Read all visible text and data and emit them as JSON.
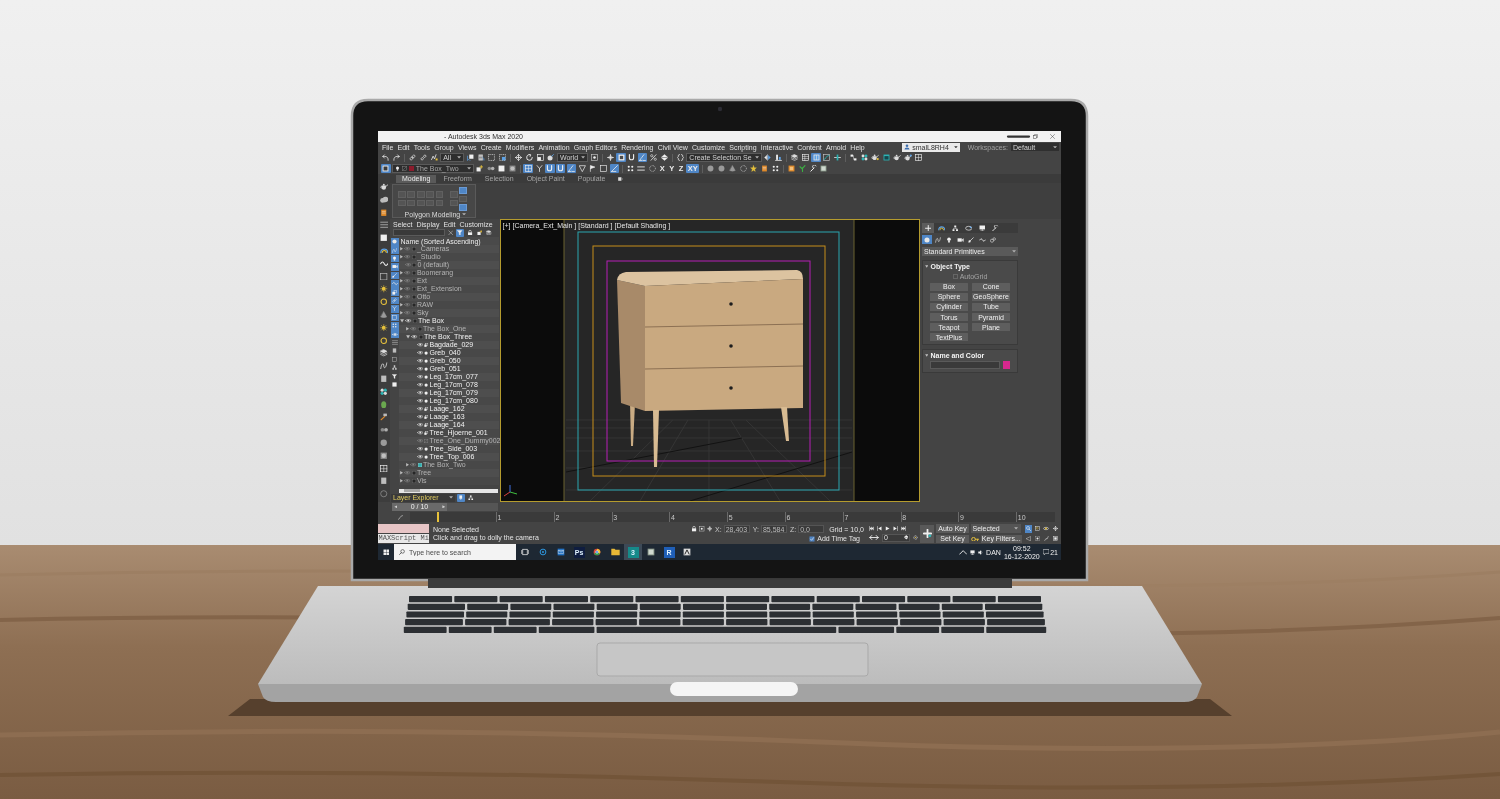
{
  "window": {
    "title": "- Autodesk 3ds Max 2020"
  },
  "menu_bar": {
    "items": [
      "File",
      "Edit",
      "Tools",
      "Group",
      "Views",
      "Create",
      "Modifiers",
      "Animation",
      "Graph Editors",
      "Rendering",
      "Civil View",
      "Customize",
      "Scripting",
      "Interactive",
      "Content",
      "Arnold",
      "Help"
    ],
    "user": "smalL8RH4",
    "workspaces_label": "Workspaces:",
    "workspace": "Default"
  },
  "main_toolbar": [
    {
      "kind": "undo",
      "on": false
    },
    {
      "kind": "redo",
      "on": false
    },
    {
      "kind": "separator"
    },
    {
      "kind": "link",
      "on": false
    },
    {
      "kind": "unlink",
      "on": false
    },
    {
      "kind": "bind",
      "on": false
    },
    {
      "kind": "dropdown",
      "value": "All"
    },
    {
      "kind": "select",
      "on": false
    },
    {
      "kind": "select_list",
      "on": false
    },
    {
      "kind": "region",
      "on": false
    },
    {
      "kind": "crossing",
      "on": false
    },
    {
      "kind": "separator"
    },
    {
      "kind": "move",
      "on": false
    },
    {
      "kind": "rotate",
      "on": false
    },
    {
      "kind": "scale",
      "on": false
    },
    {
      "kind": "placement",
      "on": false
    },
    {
      "kind": "dropdown",
      "value": "World"
    },
    {
      "kind": "pivot",
      "on": false
    },
    {
      "kind": "separator"
    },
    {
      "kind": "manipulate",
      "on": false
    },
    {
      "kind": "shortcut",
      "on": true
    },
    {
      "kind": "snap",
      "on": false
    },
    {
      "kind": "angle_snap",
      "on": true
    },
    {
      "kind": "percent_snap",
      "on": false
    },
    {
      "kind": "spinner_snap",
      "on": false
    },
    {
      "kind": "separator"
    },
    {
      "kind": "named_sets",
      "on": false
    },
    {
      "kind": "dropdown",
      "value": "Create Selection Se"
    },
    {
      "kind": "mirror",
      "on": false
    },
    {
      "kind": "align",
      "on": false
    },
    {
      "kind": "separator"
    },
    {
      "kind": "layers",
      "on": false
    },
    {
      "kind": "explorer",
      "on": false
    },
    {
      "kind": "ribbon",
      "on": true
    },
    {
      "kind": "curve_editor",
      "on": false
    },
    {
      "kind": "dope",
      "on": false
    },
    {
      "kind": "separator"
    },
    {
      "kind": "schematic",
      "on": false
    },
    {
      "kind": "material",
      "on": false
    },
    {
      "kind": "render_setup",
      "on": false
    },
    {
      "kind": "frame_window",
      "on": false
    },
    {
      "kind": "render",
      "on": false
    },
    {
      "kind": "render_cloud",
      "on": false
    },
    {
      "kind": "grid_panel",
      "on": false
    }
  ],
  "secondary_toolbar": [
    {
      "kind": "viewport_layout",
      "on": true
    },
    {
      "kind": "layer_dropdown",
      "value": "The Box_Two",
      "color": "#8c1c2c"
    },
    {
      "kind": "add_to_layer",
      "on": false
    },
    {
      "kind": "twin_spheres",
      "on": false
    },
    {
      "kind": "box",
      "on": false
    },
    {
      "kind": "sphere_box",
      "on": false
    },
    {
      "kind": "separator"
    },
    {
      "kind": "grid_panel",
      "on": true
    },
    {
      "kind": "branch",
      "on": false
    },
    {
      "kind": "snap",
      "on": true
    },
    {
      "kind": "snap",
      "on": true
    },
    {
      "kind": "angle_snap",
      "on": true
    },
    {
      "kind": "vertex",
      "on": false
    },
    {
      "kind": "flag",
      "on": false
    },
    {
      "kind": "small_square",
      "on": false
    },
    {
      "kind": "axis_constraint",
      "on": true
    },
    {
      "kind": "separator"
    },
    {
      "kind": "dots",
      "on": false
    },
    {
      "kind": "lines",
      "on": false
    },
    {
      "kind": "dotted_circle",
      "on": false
    },
    {
      "kind": "axis",
      "label": "X",
      "on": false
    },
    {
      "kind": "axis",
      "label": "Y",
      "on": false
    },
    {
      "kind": "axis",
      "label": "Z",
      "on": false
    },
    {
      "kind": "axis",
      "label": "XY",
      "on": true
    },
    {
      "kind": "separator"
    },
    {
      "kind": "sphere",
      "on": false
    },
    {
      "kind": "sphere",
      "on": false
    },
    {
      "kind": "cone",
      "on": false
    },
    {
      "kind": "dotted_circle",
      "on": false
    },
    {
      "kind": "star",
      "on": false
    },
    {
      "kind": "document",
      "on": false
    },
    {
      "kind": "dots",
      "on": false
    },
    {
      "kind": "separator"
    },
    {
      "kind": "tile",
      "on": false
    },
    {
      "kind": "plant",
      "on": false
    },
    {
      "kind": "wrench",
      "on": false
    },
    {
      "kind": "window_tile",
      "on": false
    }
  ],
  "ribbon": {
    "tabs": [
      {
        "label": "Modeling",
        "selected": true
      },
      {
        "label": "Freeform",
        "selected": false
      },
      {
        "label": "Selection",
        "selected": false
      },
      {
        "label": "Object Paint",
        "selected": false
      },
      {
        "label": "Populate",
        "selected": false
      }
    ],
    "panel_columns": [
      [
        {
          "disabled": true
        },
        {
          "disabled": true
        }
      ],
      [
        {
          "disabled": true
        },
        {
          "disabled": true
        }
      ],
      [
        {
          "disabled": true
        },
        {
          "disabled": true
        }
      ],
      [
        {
          "disabled": true
        },
        {
          "disabled": true
        }
      ],
      [
        {
          "disabled": true
        },
        {
          "disabled": true
        }
      ],
      [
        {
          "disabled": true
        },
        {
          "disabled": true
        }
      ],
      [
        {
          "disabled": false
        },
        {
          "disabled": true
        },
        {
          "disabled": false
        }
      ]
    ],
    "panel_title": "Polygon Modeling"
  },
  "scene_explorer": {
    "menu": [
      "Select",
      "Display",
      "Edit",
      "Customize"
    ],
    "search_tools": [
      {
        "kind": "clear",
        "on": false
      },
      {
        "kind": "filter",
        "on": true
      },
      {
        "kind": "lock",
        "on": false
      },
      {
        "kind": "add_to_layer",
        "on": false
      },
      {
        "kind": "layers",
        "on": false
      }
    ],
    "filter_buttons": [
      {
        "kind": "geometry",
        "on": true
      },
      {
        "kind": "shapes",
        "on": true
      },
      {
        "kind": "lights",
        "on": true
      },
      {
        "kind": "cameras",
        "on": true
      },
      {
        "kind": "helpers",
        "on": true
      },
      {
        "kind": "spacewarps",
        "on": true
      },
      {
        "kind": "groups",
        "on": true
      },
      {
        "kind": "xrefs",
        "on": true
      },
      {
        "kind": "bones",
        "on": true
      },
      {
        "kind": "containers",
        "on": true
      },
      {
        "kind": "particles",
        "on": true
      },
      {
        "kind": "visible",
        "on": true
      },
      {
        "kind": "list",
        "on": false
      },
      {
        "kind": "page",
        "on": false
      },
      {
        "kind": "frame",
        "on": false
      },
      {
        "kind": "hierarchy",
        "on": false
      },
      {
        "kind": "filter",
        "on": false
      },
      {
        "kind": "box",
        "on": false
      }
    ],
    "header": "Name (Sorted Ascending)",
    "tree": [
      {
        "name": "_Cameras",
        "kind": "layer",
        "expanded": false,
        "hidden": true,
        "current": false
      },
      {
        "name": "_Studio",
        "kind": "layer",
        "expanded": false,
        "hidden": true,
        "current": false
      },
      {
        "name": "0 (default)",
        "kind": "empty_layer",
        "expanded": false,
        "hidden": true,
        "current": false
      },
      {
        "name": "Boomerang",
        "kind": "layer",
        "expanded": false,
        "hidden": true,
        "current": false
      },
      {
        "name": "Ext",
        "kind": "layer",
        "expanded": false,
        "hidden": true,
        "current": false
      },
      {
        "name": "Ext_Extension",
        "kind": "layer",
        "expanded": false,
        "hidden": true,
        "current": false
      },
      {
        "name": "Otto",
        "kind": "layer",
        "expanded": false,
        "hidden": true,
        "current": false
      },
      {
        "name": "RAW",
        "kind": "layer",
        "expanded": false,
        "hidden": true,
        "current": false
      },
      {
        "name": "Sky",
        "kind": "layer",
        "expanded": false,
        "hidden": true,
        "current": false
      },
      {
        "name": "The Box",
        "kind": "layer",
        "expanded": true,
        "hidden": false,
        "current": false,
        "children": [
          {
            "name": "The Box_One",
            "kind": "layer",
            "expanded": false,
            "hidden": true,
            "current": false
          },
          {
            "name": "The Box_Three",
            "kind": "layer",
            "expanded": true,
            "hidden": false,
            "current": false,
            "children": [
              {
                "name": "Bagdade_029",
                "kind": "group",
                "expanded": false,
                "hidden": false,
                "current": false
              },
              {
                "name": "Greb_040",
                "kind": "object",
                "expanded": false,
                "hidden": false,
                "current": false
              },
              {
                "name": "Greb_050",
                "kind": "object",
                "expanded": false,
                "hidden": false,
                "current": false
              },
              {
                "name": "Greb_051",
                "kind": "object",
                "expanded": false,
                "hidden": false,
                "current": false
              },
              {
                "name": "Leg_17cm_077",
                "kind": "object",
                "expanded": false,
                "hidden": false,
                "current": false
              },
              {
                "name": "Leg_17cm_078",
                "kind": "object",
                "expanded": false,
                "hidden": false,
                "current": false
              },
              {
                "name": "Leg_17cm_079",
                "kind": "object",
                "expanded": false,
                "hidden": false,
                "current": false
              },
              {
                "name": "Leg_17cm_080",
                "kind": "object",
                "expanded": false,
                "hidden": false,
                "current": false
              },
              {
                "name": "Laage_162",
                "kind": "group",
                "expanded": false,
                "hidden": false,
                "current": false
              },
              {
                "name": "Laage_163",
                "kind": "group",
                "expanded": false,
                "hidden": false,
                "current": false
              },
              {
                "name": "Laage_164",
                "kind": "group",
                "expanded": false,
                "hidden": false,
                "current": false
              },
              {
                "name": "Tree_Hjoerne_001",
                "kind": "group",
                "expanded": false,
                "hidden": false,
                "current": false
              },
              {
                "name": "Tree_One_Dummy002",
                "kind": "dummy",
                "expanded": false,
                "hidden": true,
                "current": false
              },
              {
                "name": "Tree_Side_003",
                "kind": "object",
                "expanded": false,
                "hidden": false,
                "current": false
              },
              {
                "name": "Tree_Top_006",
                "kind": "object",
                "expanded": false,
                "hidden": false,
                "current": false
              }
            ]
          },
          {
            "name": "The Box_Two",
            "kind": "layer",
            "expanded": false,
            "hidden": true,
            "current": true
          }
        ]
      },
      {
        "name": "Tree",
        "kind": "layer",
        "expanded": false,
        "hidden": true,
        "current": false
      },
      {
        "name": "Vis",
        "kind": "layer",
        "expanded": false,
        "hidden": true,
        "current": false
      }
    ],
    "explorer_type": "Layer Explorer",
    "footer_tools": [
      {
        "kind": "pin",
        "on": true
      },
      {
        "kind": "hierarchy",
        "on": false
      }
    ]
  },
  "viewport": {
    "active": true,
    "labels": [
      "[+]",
      "[Camera_Ext_Main ]",
      "[Standard ]",
      "[Default Shading ]"
    ]
  },
  "command_panel": {
    "tabs": [
      {
        "kind": "create",
        "selected": true
      },
      {
        "kind": "modify",
        "selected": false
      },
      {
        "kind": "hierarchy",
        "selected": false
      },
      {
        "kind": "motion",
        "selected": false
      },
      {
        "kind": "display",
        "selected": false
      },
      {
        "kind": "utilities",
        "selected": false
      }
    ],
    "categories": [
      {
        "kind": "geometry",
        "selected": true
      },
      {
        "kind": "shapes",
        "selected": false
      },
      {
        "kind": "lights",
        "selected": false
      },
      {
        "kind": "cameras",
        "selected": false
      },
      {
        "kind": "helpers",
        "selected": false
      },
      {
        "kind": "spacewarps",
        "selected": false
      },
      {
        "kind": "systems",
        "selected": false
      }
    ],
    "object_class": "Standard Primitives",
    "rollouts": [
      {
        "kind": "object_type",
        "title": "Object Type",
        "expanded": true,
        "autogrid": {
          "label": "AutoGrid",
          "checked": false,
          "disabled": true
        },
        "buttons": [
          "Box",
          "Cone",
          "Sphere",
          "GeoSphere",
          "Cylinder",
          "Tube",
          "Torus",
          "Pyramid",
          "Teapot",
          "Plane",
          "TextPlus"
        ]
      },
      {
        "kind": "name_color",
        "title": "Name and Color",
        "expanded": true,
        "color": "#d6288e"
      }
    ]
  },
  "time_slider": {
    "label": "0 / 10",
    "level": 0
  },
  "track_bar": {
    "frames": [
      "1",
      "2",
      "3",
      "4",
      "5",
      "6",
      "7",
      "8",
      "9",
      "10"
    ],
    "mini_curve_editor": {
      "on": false
    }
  },
  "status": {
    "listener_output": "MAXScript Mi",
    "selection": "None Selected",
    "prompt": "Click and drag to dolly the camera",
    "coordinates": [
      {
        "label": "X:",
        "value": "28,403"
      },
      {
        "label": "Y:",
        "value": "85,584"
      },
      {
        "label": "Z:",
        "value": "0,0"
      }
    ],
    "grid": "Grid = 10,0",
    "time_tag": "Add Time Tag",
    "frame": "0",
    "auto_key": "Auto Key",
    "key_mode": "Selected",
    "set_key": "Set Key",
    "key_filters": "Key Filters..."
  },
  "taskbar": {
    "search_placeholder": "Type here to search",
    "apps": [
      {
        "kind": "task_view",
        "active": false
      },
      {
        "kind": "ring",
        "active": false
      },
      {
        "kind": "mail",
        "active": false
      },
      {
        "kind": "tile",
        "label": "Ps",
        "color": "#0f1d40",
        "active": false
      },
      {
        "kind": "browser",
        "active": false
      },
      {
        "kind": "folder",
        "active": false
      },
      {
        "kind": "tile",
        "label": "3",
        "color": "#168a8a",
        "active": true
      },
      {
        "kind": "window",
        "active": false
      },
      {
        "kind": "tile",
        "label": "R",
        "color": "#1f5fb8",
        "active": false
      },
      {
        "kind": "app",
        "active": false
      }
    ],
    "language": "DAN",
    "time": "09:52",
    "date": "16-12-2020",
    "notifications": "21"
  }
}
